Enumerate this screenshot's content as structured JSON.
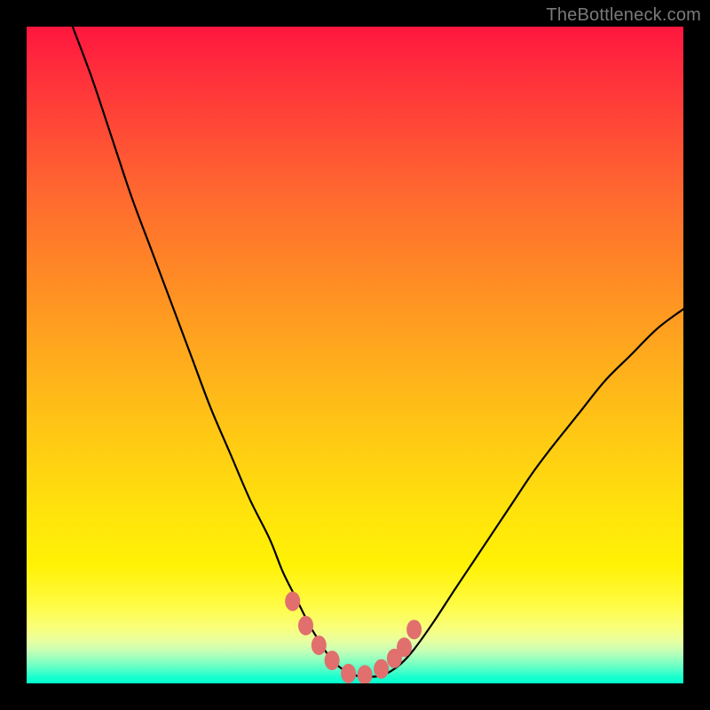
{
  "attribution": "TheBottleneck.com",
  "colors": {
    "frame": "#000000",
    "curve_stroke": "#000000",
    "marker_fill": "#e06f6e",
    "gradient_top": "#ff163f",
    "gradient_bottom": "#03ffd1"
  },
  "chart_data": {
    "type": "line",
    "title": "",
    "xlabel": "",
    "ylabel": "",
    "xlim": [
      0,
      100
    ],
    "ylim": [
      0,
      100
    ],
    "grid": false,
    "legend": false,
    "x": [
      7,
      10,
      13,
      16,
      19,
      22,
      25,
      28,
      31,
      34,
      37,
      39,
      41,
      43,
      44.5,
      46,
      47.5,
      49,
      50.5,
      52,
      53.5,
      55,
      57,
      59,
      62,
      65,
      68,
      71,
      74,
      77,
      80,
      84,
      88,
      92,
      96,
      100
    ],
    "values": [
      100,
      92,
      83,
      74,
      66,
      58,
      50,
      42,
      35,
      28,
      22,
      17,
      13,
      9,
      6.5,
      4.2,
      2.6,
      1.6,
      1.1,
      1.0,
      1.1,
      1.6,
      3.0,
      5.2,
      9.4,
      14,
      18.5,
      23,
      27.5,
      32,
      36,
      41,
      46,
      50,
      54,
      57
    ],
    "markers": {
      "x": [
        40.5,
        42.5,
        44.5,
        46.5,
        49,
        51.5,
        54,
        56,
        57.5,
        59
      ],
      "y": [
        12.5,
        8.8,
        5.8,
        3.5,
        1.5,
        1.3,
        2.2,
        3.8,
        5.5,
        8.2
      ]
    },
    "background": {
      "type": "vertical-gradient",
      "stops": [
        {
          "pos": 0.0,
          "color": "#ff163f"
        },
        {
          "pos": 0.5,
          "color": "#ffaa1d"
        },
        {
          "pos": 0.82,
          "color": "#fff205"
        },
        {
          "pos": 0.95,
          "color": "#c8ffb4"
        },
        {
          "pos": 1.0,
          "color": "#03ffd1"
        }
      ]
    }
  }
}
